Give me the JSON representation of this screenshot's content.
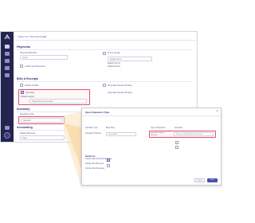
{
  "colors": {
    "rail": "#23244f",
    "accent": "#2f3470",
    "highlight": "#e2506a",
    "wedge": "#f5d49a"
  },
  "breadcrumb": {
    "back": "‹ Sales CA",
    "sep": "/",
    "current": "Test Card (edit)"
  },
  "payments": {
    "title": "Payments",
    "payment_method_label": "Payment Methods",
    "payment_method_value": "Select",
    "credit_card_label": "Credit Card Payments",
    "terms_label": "Terms Length",
    "terms_value": "Default Terms",
    "terms2_label": "Default Terms",
    "terms3_label": "Default Terms"
  },
  "bills": {
    "title": "Bills & Receipts",
    "checkbox1_label": "Enable for Bills",
    "checkbox2_label": "Automatic Receipt Printing",
    "highlight_checkbox_label": "Summary",
    "highlight_input_label": "Default Layout",
    "highlight_input_value": "Default Receipt Template"
  },
  "summary": {
    "title": "Summary",
    "field_label": "Operation Type",
    "field_value": "Standard"
  },
  "accounting": {
    "title": "Accounting",
    "field_label": "Default Revenue",
    "field_value": "Sales"
  },
  "dialog": {
    "title": "Open Operation Type",
    "close": "×",
    "field1_label": "Operation Type",
    "field1_value": "",
    "field2_label": "Operation Products",
    "field3_label": "Base Price",
    "field3_value": "Project Blue",
    "field4_label": "Type of Operation",
    "field5_label": "Operation",
    "hl_label": "Operation Type for Revenue",
    "hl_value": "Revenue on Billing/Revenue Invoice",
    "section_title": "Sections",
    "row1_label": "Include other Summary Revenue",
    "row2_label": "Include also Revenues",
    "row3_label": "Include other Revenues",
    "cancel_label": "Cancel",
    "save_label": "Save"
  }
}
